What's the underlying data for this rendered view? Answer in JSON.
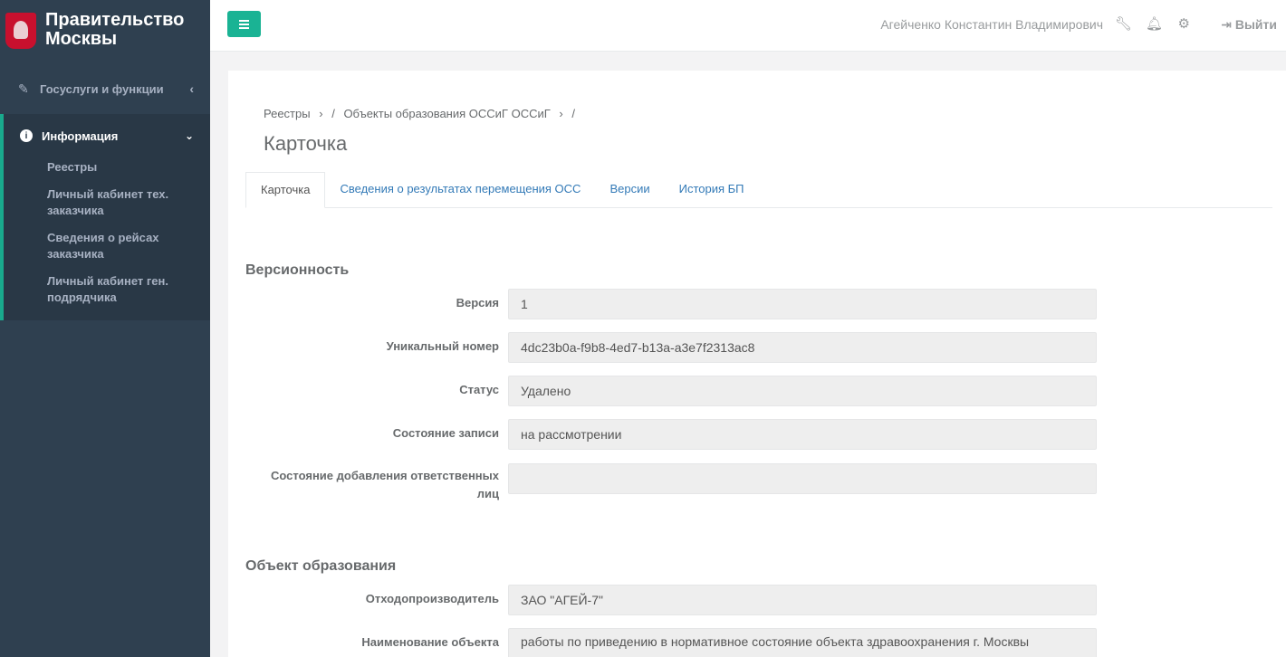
{
  "brand": {
    "line1": "Правительство",
    "line2": "Москвы"
  },
  "sidebar": {
    "gosuslugi": "Госуслуги и функции",
    "info": "Информация",
    "items": [
      {
        "label": "Реестры"
      },
      {
        "label": "Личный кабинет тех. заказчика"
      },
      {
        "label": "Сведения о рейсах заказчика"
      },
      {
        "label": "Личный кабинет ген. подрядчика"
      }
    ]
  },
  "topbar": {
    "user": "Агейченко Константин Владимирович",
    "logout": "Выйти"
  },
  "breadcrumb": {
    "item1": "Реестры",
    "sep1": "›",
    "slash1": "/",
    "item2": "Объекты образования ОССиГ ОССиГ",
    "sep2": "›",
    "slash2": "/"
  },
  "page_title": "Карточка",
  "tabs": [
    "Карточка",
    "Сведения о результатах перемещения ОСС",
    "Версии",
    "История БП"
  ],
  "sections": {
    "versioning": {
      "title": "Версионность",
      "fields": [
        {
          "label": "Версия",
          "value": "1"
        },
        {
          "label": "Уникальный номер",
          "value": "4dc23b0a-f9b8-4ed7-b13a-a3e7f2313ac8"
        },
        {
          "label": "Статус",
          "value": "Удалено"
        },
        {
          "label": "Состояние записи",
          "value": "на рассмотрении"
        },
        {
          "label": "Состояние добавления ответственных лиц",
          "value": ""
        }
      ]
    },
    "object": {
      "title": "Объект образования",
      "fields": [
        {
          "label": "Отходопроизводитель",
          "value": "ЗАО \"АГЕЙ-7\""
        },
        {
          "label": "Наименование объекта",
          "value": "работы по приведению в нормативное состояние объекта здравоохранения г. Москвы"
        }
      ]
    }
  }
}
